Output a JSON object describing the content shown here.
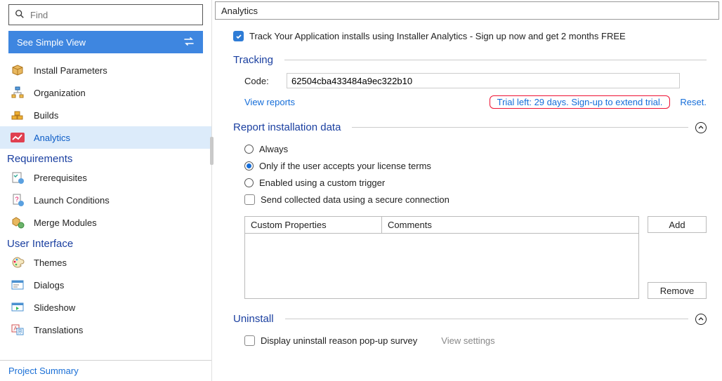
{
  "search": {
    "placeholder": "Find"
  },
  "simpleView": {
    "label": "See Simple View"
  },
  "nav": {
    "group1": [
      {
        "label": "Install Parameters"
      },
      {
        "label": "Organization"
      },
      {
        "label": "Builds"
      },
      {
        "label": "Analytics"
      }
    ],
    "sections": {
      "requirements": "Requirements",
      "userInterface": "User Interface"
    },
    "group2": [
      {
        "label": "Prerequisites"
      },
      {
        "label": "Launch Conditions"
      },
      {
        "label": "Merge Modules"
      }
    ],
    "group3": [
      {
        "label": "Themes"
      },
      {
        "label": "Dialogs"
      },
      {
        "label": "Slideshow"
      },
      {
        "label": "Translations"
      }
    ]
  },
  "projectSummary": "Project Summary",
  "header": {
    "title": "Analytics"
  },
  "trackCheckbox": {
    "label": "Track Your Application installs using Installer Analytics - Sign up now and get 2 months FREE"
  },
  "tracking": {
    "title": "Tracking",
    "codeLabel": "Code:",
    "codeValue": "62504cba433484a9ec322b10",
    "viewReports": "View reports",
    "trialText": "Trial left: 29 days. Sign-up to extend trial.",
    "reset": "Reset."
  },
  "report": {
    "title": "Report installation data",
    "opt1": "Always",
    "opt2": "Only if the user accepts your license terms",
    "opt3": "Enabled using a custom trigger",
    "secure": "Send collected data using a secure connection",
    "colProps": "Custom Properties",
    "colComments": "Comments",
    "add": "Add",
    "remove": "Remove"
  },
  "uninstall": {
    "title": "Uninstall",
    "survey": "Display uninstall reason pop-up survey",
    "viewSettings": "View settings"
  }
}
